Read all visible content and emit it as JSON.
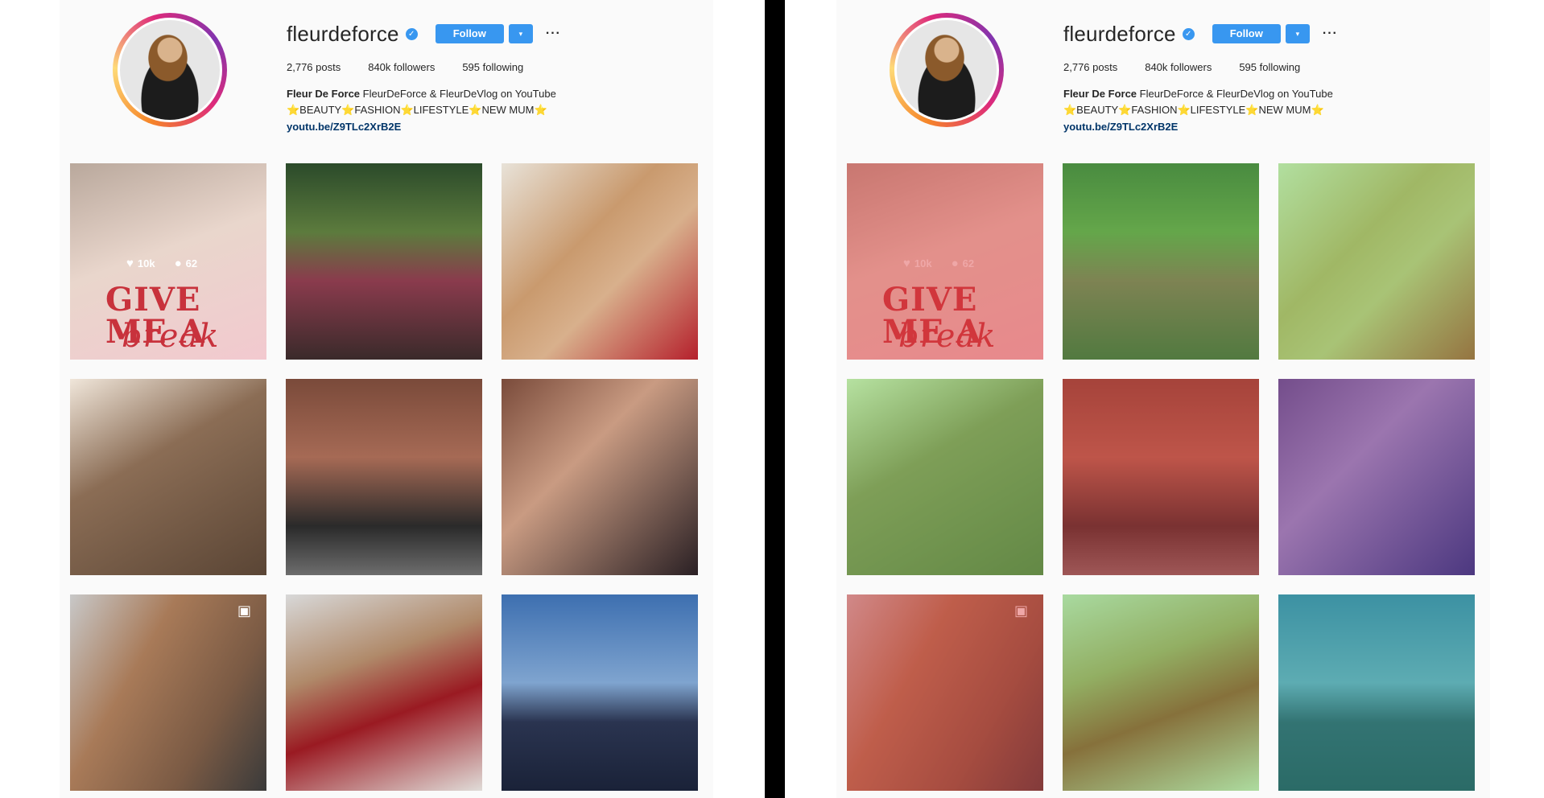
{
  "profile": {
    "handle": "fleurdeforce",
    "follow_label": "Follow",
    "dropdown_glyph": "▾",
    "more_glyph": "···",
    "verified_glyph": "✓",
    "stats": {
      "posts": "2,776 posts",
      "followers": "840k followers",
      "following": "595 following"
    },
    "bio_name": "Fleur De Force",
    "bio_rest": "FleurDeForce & FleurDeVlog on YouTube",
    "bio_line": "⭐BEAUTY⭐FASHION⭐LIFESTYLE⭐NEW MUM⭐",
    "link": "youtu.be/Z9TLc2XrB2E"
  },
  "tile1": {
    "likes": "10k",
    "comments": "62",
    "shirt_line1": "GIVE ME A",
    "shirt_line2": "break"
  },
  "icons": {
    "heart": "♥",
    "comment": "●",
    "video": "▣"
  },
  "colors": {
    "follow_blue": "#3897f0",
    "link_blue": "#003569",
    "panel_bg": "#fafafa",
    "divider": "#000000"
  }
}
